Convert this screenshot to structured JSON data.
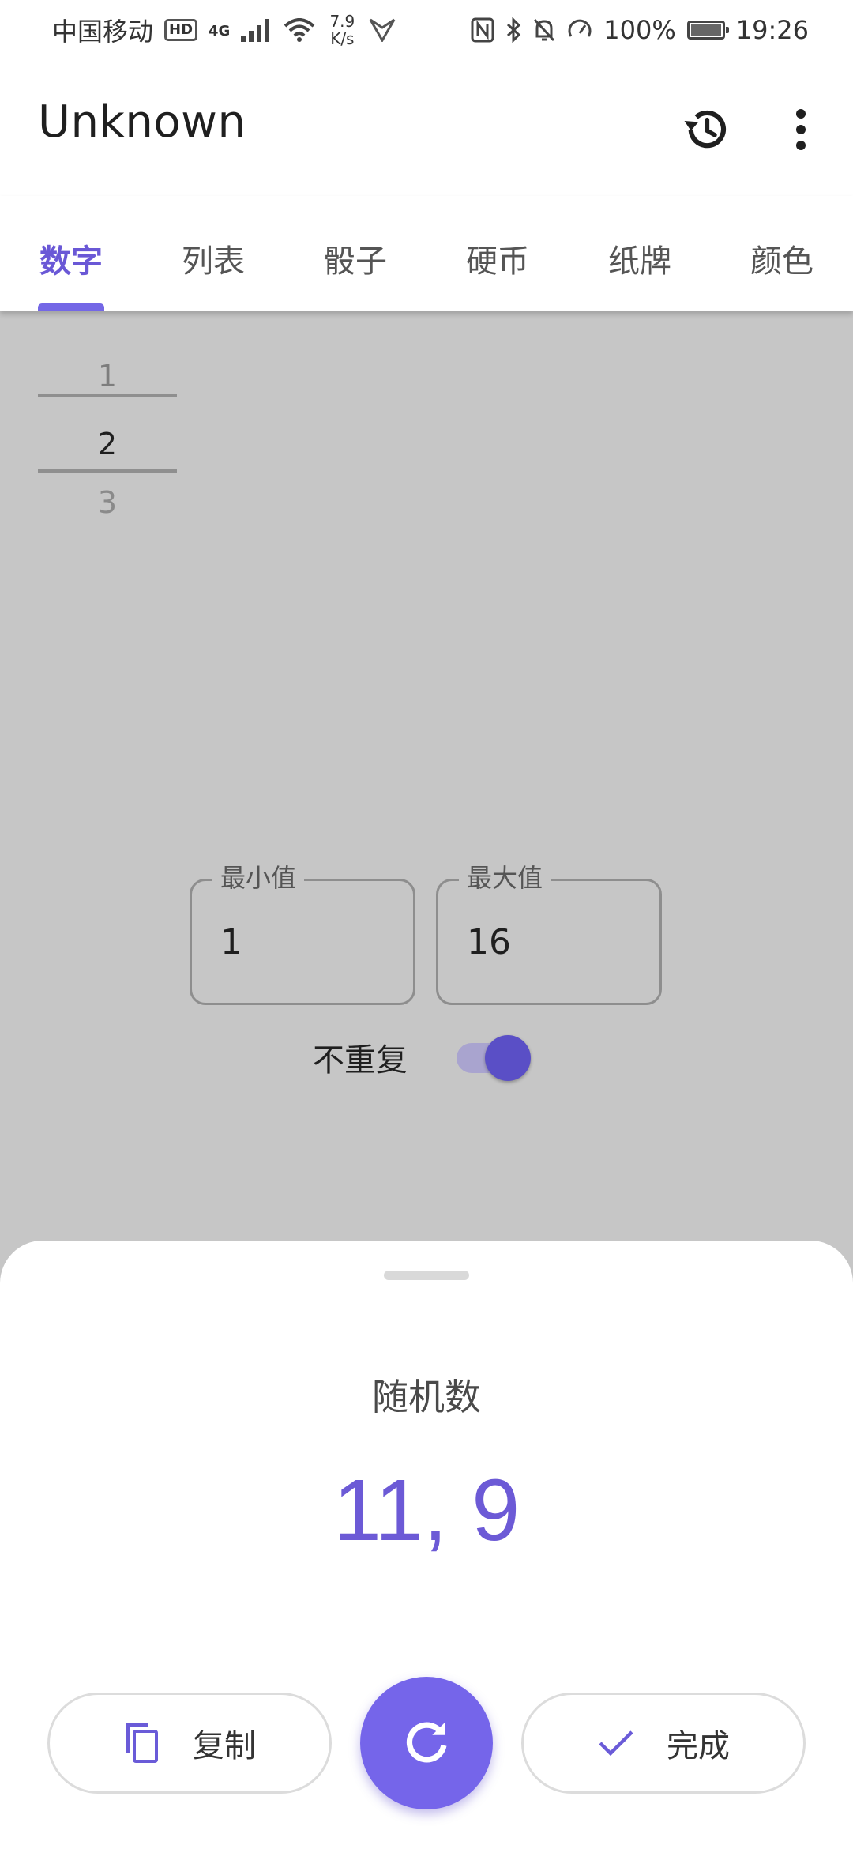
{
  "status_bar": {
    "carrier": "中国移动",
    "hd": "HD",
    "network": "4G",
    "speed_value": "7.9",
    "speed_unit": "K/s",
    "battery": "100%",
    "time": "19:26"
  },
  "app_bar": {
    "title": "Unknown",
    "icons": [
      "history-icon",
      "more-vert-icon"
    ]
  },
  "tabs": [
    {
      "label": "数字",
      "active": true
    },
    {
      "label": "列表",
      "active": false
    },
    {
      "label": "骰子",
      "active": false
    },
    {
      "label": "硬币",
      "active": false
    },
    {
      "label": "纸牌",
      "active": false
    },
    {
      "label": "颜色",
      "active": false
    }
  ],
  "picker": {
    "values": [
      "1",
      "2",
      "3"
    ],
    "selected": "2"
  },
  "range": {
    "min_label": "最小值",
    "min_value": "1",
    "max_label": "最大值",
    "max_value": "16"
  },
  "no_repeat": {
    "label": "不重复",
    "enabled": true
  },
  "sheet": {
    "title": "随机数",
    "result": "11, 9",
    "copy_label": "复制",
    "done_label": "完成"
  },
  "colors": {
    "accent": "#7467e6",
    "result_text": "#6c5ad6",
    "overlay": "#c6c6c6",
    "toggle_thumb": "#5a4fc6"
  }
}
